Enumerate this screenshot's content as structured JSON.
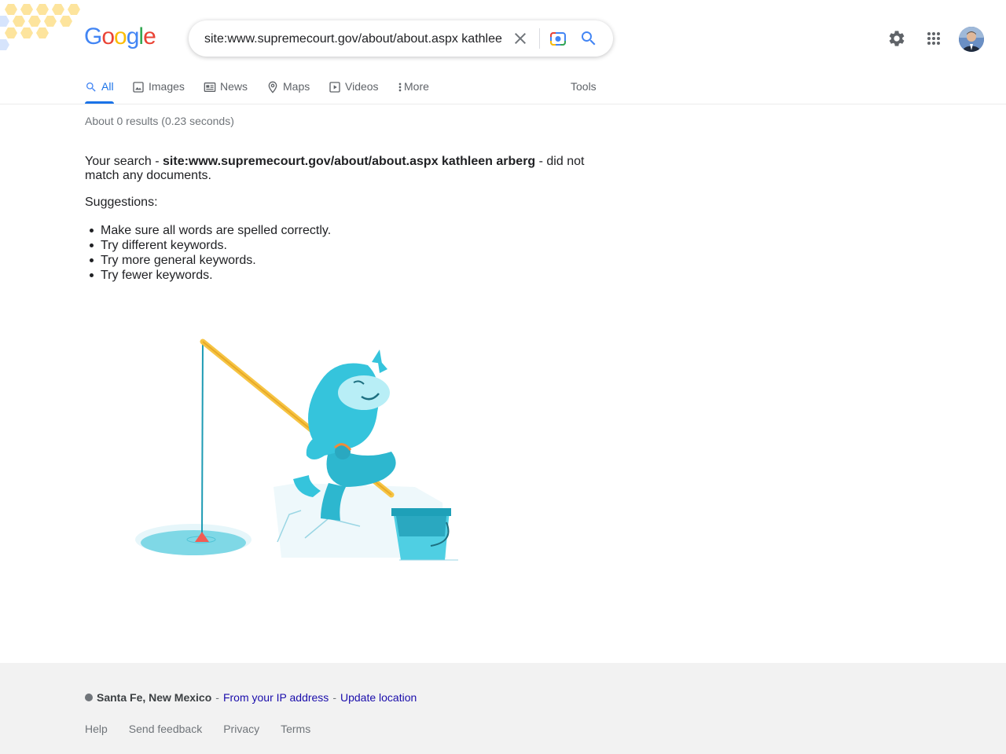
{
  "header": {
    "logo_letters": [
      "G",
      "o",
      "o",
      "g",
      "l",
      "e"
    ],
    "search_value": "site:www.supremecourt.gov/about/about.aspx kathleen arberg"
  },
  "tabs": [
    {
      "label": "All",
      "icon": "search-icon"
    },
    {
      "label": "Images",
      "icon": "image-icon"
    },
    {
      "label": "News",
      "icon": "news-icon"
    },
    {
      "label": "Maps",
      "icon": "map-pin-icon"
    },
    {
      "label": "Videos",
      "icon": "video-icon"
    },
    {
      "label": "More",
      "icon": "more-vert-icon"
    }
  ],
  "tools_label": "Tools",
  "results": {
    "stats": "About 0 results (0.23 seconds)",
    "prefix": "Your search - ",
    "query": "site:www.supremecourt.gov/about/about.aspx kathleen arberg",
    "suffix": " - did not match any documents.",
    "suggestions_title": "Suggestions:",
    "suggestions": [
      "Make sure all words are spelled correctly.",
      "Try different keywords.",
      "Try more general keywords.",
      "Try fewer keywords."
    ]
  },
  "footer": {
    "location": "Santa Fe, New Mexico",
    "sep": "-",
    "from_ip": "From your IP address",
    "update": "Update location",
    "links": [
      "Help",
      "Send feedback",
      "Privacy",
      "Terms"
    ]
  },
  "colors": {
    "blue": "#4285f4",
    "red": "#ea4335",
    "yellow": "#fbbc05",
    "green": "#34a853",
    "link": "#1a0dab",
    "active_tab": "#1a73e8"
  }
}
